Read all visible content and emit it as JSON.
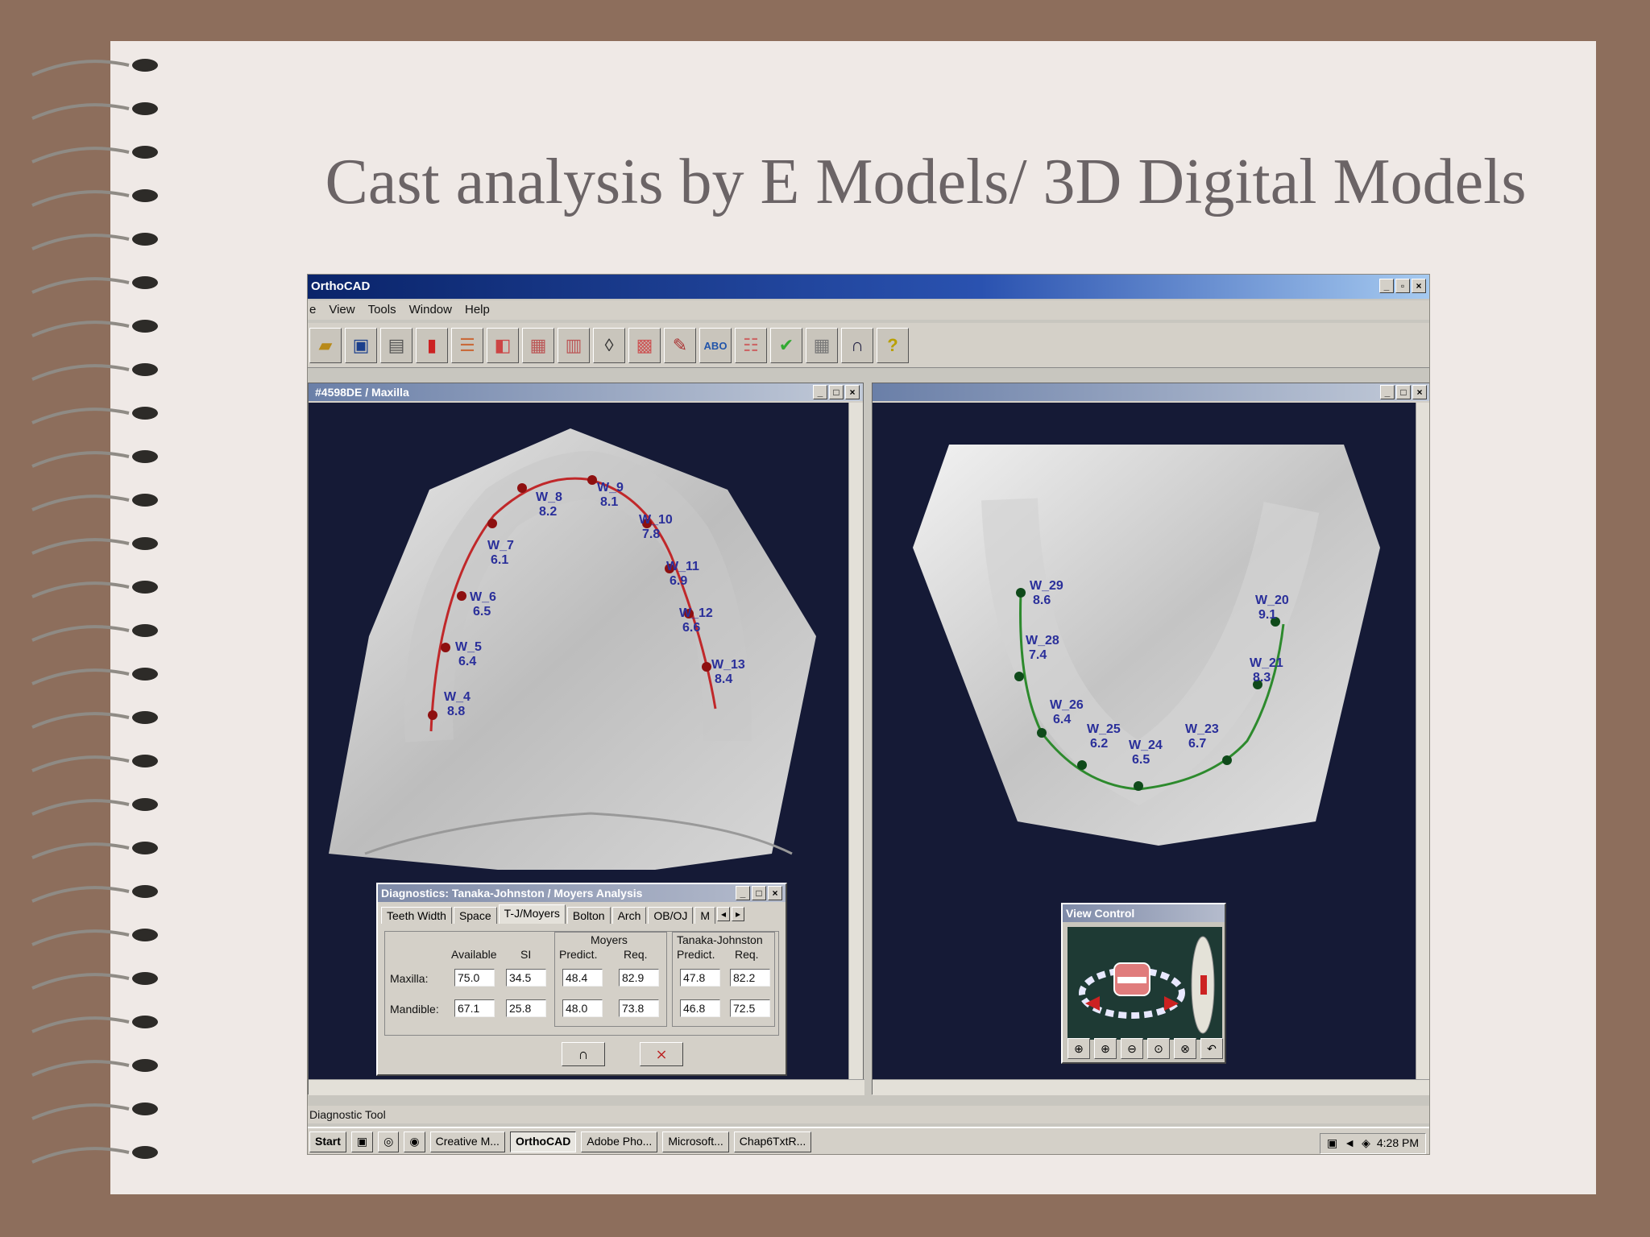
{
  "slide": {
    "title": "Cast analysis by E Models/ 3D Digital Models"
  },
  "app": {
    "title": "OrthoCAD",
    "menu": [
      "e",
      "View",
      "Tools",
      "Window",
      "Help"
    ],
    "toolbar_icons": [
      "open-icon",
      "save-icon",
      "print-icon",
      "record-icon",
      "models-icon",
      "split-icon",
      "teeth-icon",
      "occlusion-icon",
      "rotate-icon",
      "stack-icon",
      "ruler-icon",
      "abo-icon",
      "models2-icon",
      "check-icon",
      "table-icon",
      "arch-icon",
      "help-icon"
    ],
    "toolbar_abo": "ABO",
    "toolbar_help": "?"
  },
  "left_window": {
    "title_suffix": "#4598DE / Maxilla",
    "maxilla_labels": [
      {
        "name": "W_9",
        "val": "8.1"
      },
      {
        "name": "W_8",
        "val": "8.2"
      },
      {
        "name": "W_10",
        "val": "7.8"
      },
      {
        "name": "W_7",
        "val": "6.1"
      },
      {
        "name": "W_11",
        "val": "6.9"
      },
      {
        "name": "W_6",
        "val": "6.5"
      },
      {
        "name": "W_12",
        "val": "6.6"
      },
      {
        "name": "W_5",
        "val": "6.4"
      },
      {
        "name": "W_13",
        "val": "8.4"
      },
      {
        "name": "W_4",
        "val": "8.8"
      }
    ]
  },
  "right_window": {
    "mandible_labels": [
      {
        "name": "W_29",
        "val": "8.6"
      },
      {
        "name": "W_20",
        "val": "9.1"
      },
      {
        "name": "W_28",
        "val": "7.4"
      },
      {
        "name": "W_21",
        "val": "8.3"
      },
      {
        "name": "W_26",
        "val": "6.4"
      },
      {
        "name": "W_25",
        "val": "6.2"
      },
      {
        "name": "W_24",
        "val": "6.5"
      },
      {
        "name": "W_23",
        "val": "6.7"
      }
    ]
  },
  "diagnostics": {
    "title": "Diagnostics: Tanaka-Johnston / Moyers Analysis",
    "tabs": [
      "Teeth Width",
      "Space",
      "T-J/Moyers",
      "Bolton",
      "Arch",
      "OB/OJ",
      "M"
    ],
    "active_tab": "T-J/Moyers",
    "group_moyers": "Moyers",
    "group_tj": "Tanaka-Johnston",
    "col_available": "Available",
    "col_si": "SI",
    "col_predict": "Predict.",
    "col_req": "Req.",
    "row_maxilla": "Maxilla:",
    "row_mandible": "Mandible:",
    "maxilla": {
      "available": "75.0",
      "si": "34.5",
      "moyers_predict": "48.4",
      "moyers_req": "82.9",
      "tj_predict": "47.8",
      "tj_req": "82.2"
    },
    "mandible": {
      "available": "67.1",
      "si": "25.8",
      "moyers_predict": "48.0",
      "moyers_req": "73.8",
      "tj_predict": "46.8",
      "tj_req": "72.5"
    }
  },
  "view_control": {
    "title": "View Control"
  },
  "status": {
    "text": "Diagnostic Tool"
  },
  "taskbar": {
    "start": "Start",
    "items": [
      "Creative M...",
      "OrthoCAD",
      "Adobe Pho...",
      "Microsoft...",
      "Chap6TxtR..."
    ],
    "active": "OrthoCAD",
    "clock": "4:28 PM"
  }
}
